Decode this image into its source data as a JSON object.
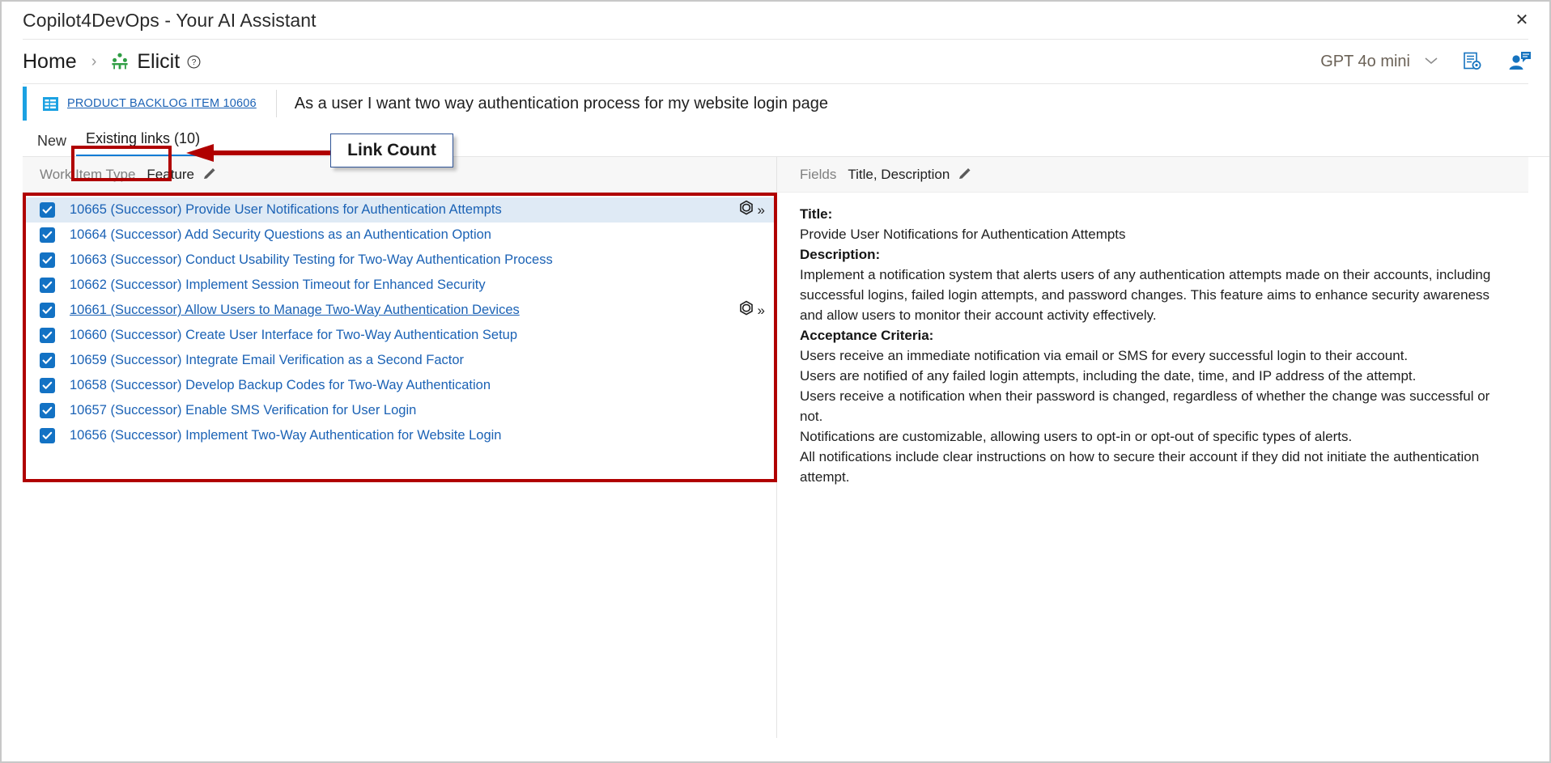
{
  "window": {
    "title": "Copilot4DevOps - Your AI Assistant",
    "close_label": "✕"
  },
  "breadcrumb": {
    "home": "Home",
    "separator": "›",
    "current": "Elicit",
    "elicit_icon": "meeting-people-icon",
    "help_icon": "help-circle-icon"
  },
  "header_right": {
    "model": "GPT 4o mini",
    "chevron": "⌄",
    "settings_icon": "document-settings-icon",
    "profile_icon": "user-chat-icon"
  },
  "work_item": {
    "type_link": "PRODUCT BACKLOG ITEM 10606",
    "title": "As a user I want two way authentication process for my website login page",
    "icon": "backlog-item-icon"
  },
  "tabs": [
    {
      "label": "New",
      "active": false
    },
    {
      "label": "Existing links (10)",
      "active": true
    }
  ],
  "annotations": {
    "callout_text": "Link Count",
    "accent_color": "#b00000"
  },
  "left_pane": {
    "filter_label": "Work Item Type",
    "filter_value": "Feature",
    "edit_icon": "pencil-icon",
    "rows": [
      {
        "id": "10665",
        "relation": "(Successor)",
        "title": "Provide User Notifications for Authentication Attempts",
        "checked": true,
        "selected": true,
        "hovered": false,
        "has_actions": true
      },
      {
        "id": "10664",
        "relation": "(Successor)",
        "title": "Add Security Questions as an Authentication Option",
        "checked": true,
        "selected": false,
        "hovered": false,
        "has_actions": false
      },
      {
        "id": "10663",
        "relation": "(Successor)",
        "title": "Conduct Usability Testing for Two-Way Authentication Process",
        "checked": true,
        "selected": false,
        "hovered": false,
        "has_actions": false
      },
      {
        "id": "10662",
        "relation": "(Successor)",
        "title": "Implement Session Timeout for Enhanced Security",
        "checked": true,
        "selected": false,
        "hovered": false,
        "has_actions": false
      },
      {
        "id": "10661",
        "relation": "(Successor)",
        "title": "Allow Users to Manage Two-Way Authentication Devices",
        "checked": true,
        "selected": false,
        "hovered": true,
        "has_actions": true
      },
      {
        "id": "10660",
        "relation": "(Successor)",
        "title": "Create User Interface for Two-Way Authentication Setup",
        "checked": true,
        "selected": false,
        "hovered": false,
        "has_actions": false
      },
      {
        "id": "10659",
        "relation": "(Successor)",
        "title": "Integrate Email Verification as a Second Factor",
        "checked": true,
        "selected": false,
        "hovered": false,
        "has_actions": false
      },
      {
        "id": "10658",
        "relation": "(Successor)",
        "title": "Develop Backup Codes for Two-Way Authentication",
        "checked": true,
        "selected": false,
        "hovered": false,
        "has_actions": false
      },
      {
        "id": "10657",
        "relation": "(Successor)",
        "title": "Enable SMS Verification for User Login",
        "checked": true,
        "selected": false,
        "hovered": false,
        "has_actions": false
      },
      {
        "id": "10656",
        "relation": "(Successor)",
        "title": "Implement Two-Way Authentication for Website Login",
        "checked": true,
        "selected": false,
        "hovered": false,
        "has_actions": false
      }
    ]
  },
  "right_pane": {
    "fields_label": "Fields",
    "fields_value": "Title, Description",
    "edit_icon": "pencil-icon",
    "title_label": "Title:",
    "title_value": "Provide User Notifications for Authentication Attempts",
    "description_label": "Description:",
    "description_value": "Implement a notification system that alerts users of any authentication attempts made on their accounts, including successful logins, failed login attempts, and password changes. This feature aims to enhance security awareness and allow users to monitor their account activity effectively.",
    "acceptance_label": "Acceptance Criteria:",
    "acceptance_lines": [
      "Users receive an immediate notification via email or SMS for every successful login to their account.",
      "Users are notified of any failed login attempts, including the date, time, and IP address of the attempt.",
      "Users receive a notification when their password is changed, regardless of whether the change was successful or not.",
      "Notifications are customizable, allowing users to opt-in or opt-out of specific types of alerts.",
      "All notifications include clear instructions on how to secure their account if they did not initiate the authentication attempt."
    ]
  }
}
